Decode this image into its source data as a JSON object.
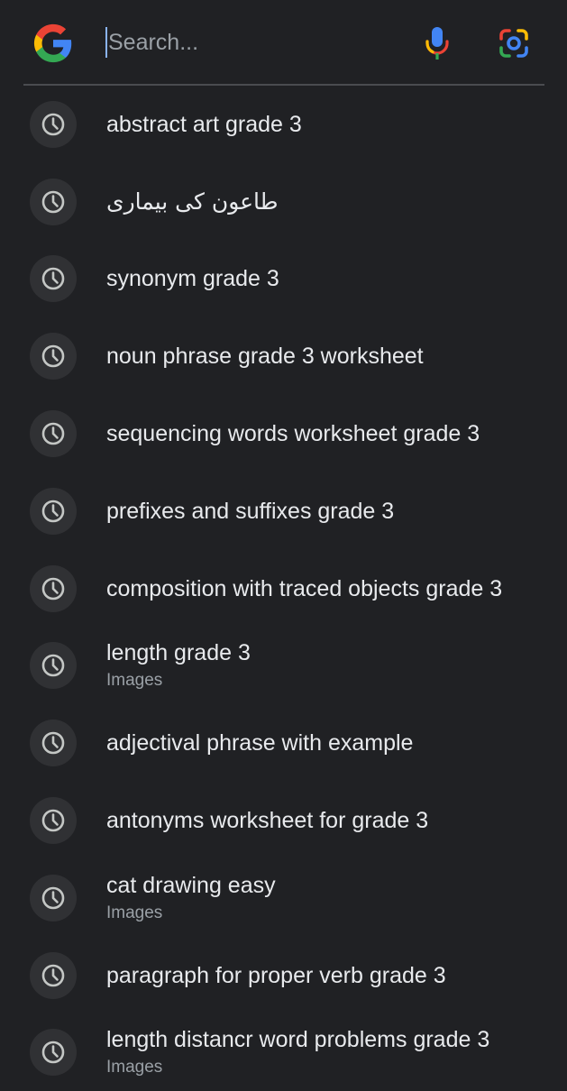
{
  "search": {
    "placeholder": "Search..."
  },
  "history": [
    {
      "label": "abstract art grade 3",
      "sub": ""
    },
    {
      "label": "طاعون کی بیماری",
      "sub": ""
    },
    {
      "label": "synonym grade 3",
      "sub": ""
    },
    {
      "label": "noun phrase grade 3 worksheet",
      "sub": ""
    },
    {
      "label": "sequencing words worksheet grade 3",
      "sub": ""
    },
    {
      "label": "prefixes and suffixes grade 3",
      "sub": ""
    },
    {
      "label": "composition with traced objects grade 3",
      "sub": ""
    },
    {
      "label": "length grade 3",
      "sub": "Images"
    },
    {
      "label": "adjectival phrase with example",
      "sub": ""
    },
    {
      "label": "antonyms worksheet for grade 3",
      "sub": ""
    },
    {
      "label": "cat drawing easy",
      "sub": "Images"
    },
    {
      "label": "paragraph for proper verb grade 3",
      "sub": ""
    },
    {
      "label": "length distancr word problems grade 3",
      "sub": "Images"
    }
  ],
  "icons": {
    "logo": "google-g-logo",
    "mic": "microphone-icon",
    "lens": "google-lens-icon",
    "history": "clock-history-icon"
  },
  "colors": {
    "background": "#202124",
    "text": "#e8eaed",
    "subtext": "#9aa0a6",
    "icon_circle": "#303134",
    "blue": "#4285f4",
    "red": "#ea4335",
    "yellow": "#fbbc05",
    "green": "#34a853"
  }
}
